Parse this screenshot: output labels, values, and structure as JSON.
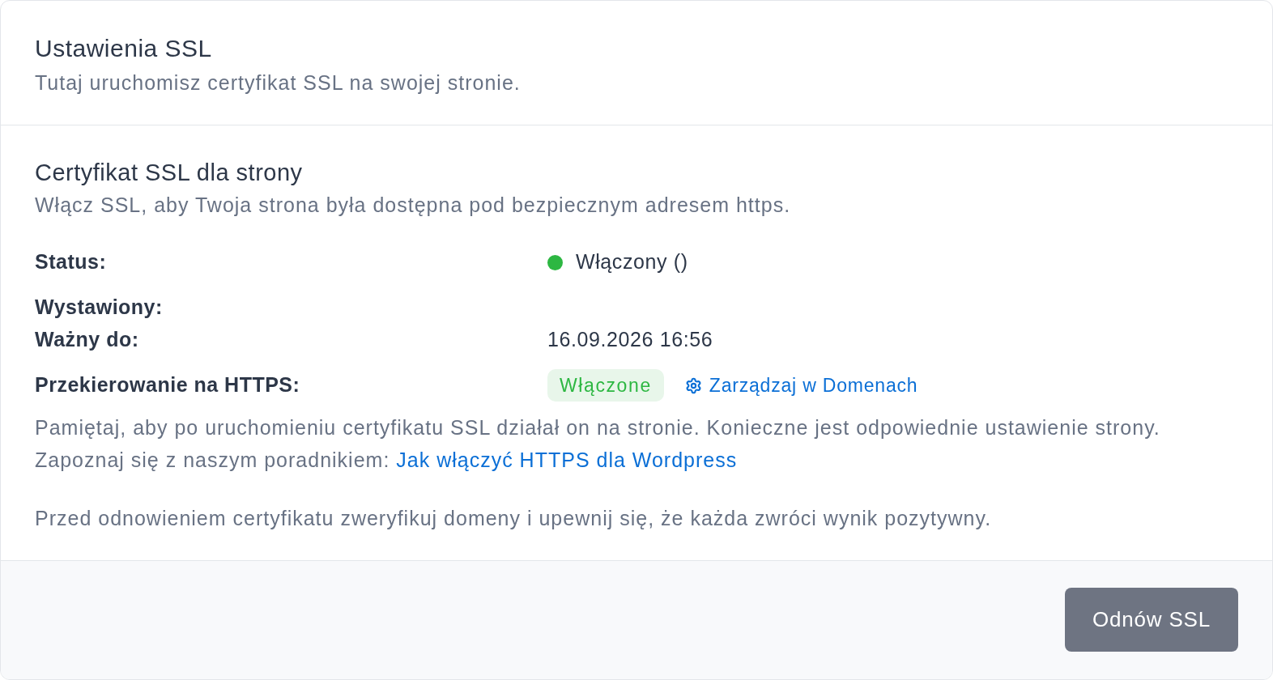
{
  "header": {
    "title": "Ustawienia SSL",
    "subtitle": "Tutaj uruchomisz certyfikat SSL na swojej stronie."
  },
  "certificate": {
    "title": "Certyfikat SSL dla strony",
    "description": "Włącz SSL, aby Twoja strona była dostępna pod bezpiecznym adresem https.",
    "details": [
      {
        "kind": "status",
        "label": "Status:",
        "value": "Włączony ()",
        "enabled": true
      },
      {
        "kind": "text",
        "label": "Wystawiony:"
      },
      {
        "kind": "text",
        "label": "Ważny do:",
        "value": "16.09.2026 16:56"
      },
      {
        "kind": "redirect",
        "label": "Przekierowanie na HTTPS:",
        "badge": "Włączone",
        "on": true,
        "link": "Zarządzaj w Domenach"
      }
    ],
    "note": {
      "line_1": "Pamiętaj, aby po uruchomieniu certyfikatu SSL działał on na stronie. Konieczne jest odpowiednie ustawienie strony.",
      "line_2": "Zapoznaj się z naszym poradnikiem: ",
      "link": "Jak włączyć HTTPS dla Wordpress"
    },
    "warning": "Przed odnowieniem certyfikatu zweryfikuj domeny i upewnij się, że każda zwróci wynik pozytywny."
  },
  "footer": {
    "button": "Odnów SSL"
  }
}
